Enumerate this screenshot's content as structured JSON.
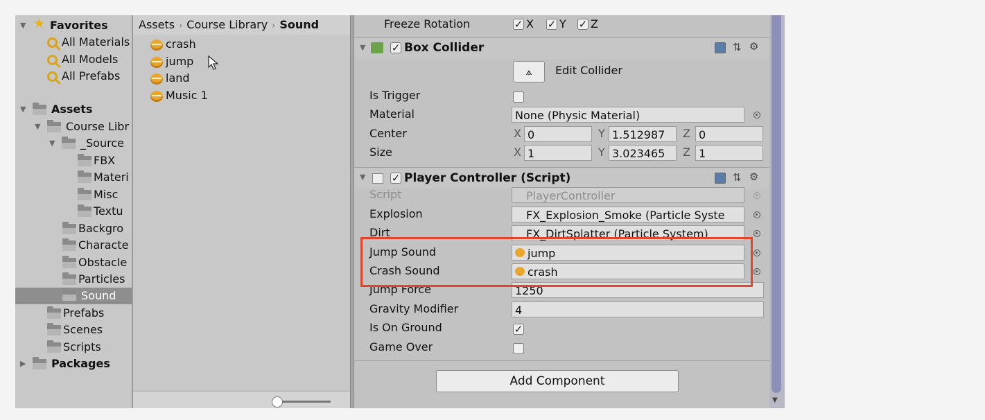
{
  "tree": {
    "favorites_label": "Favorites",
    "favorites": [
      "All Materials",
      "All Models",
      "All Prefabs"
    ],
    "assets_label": "Assets",
    "course_library": "Course Libr",
    "source_folder": "_Source",
    "source_children": [
      "FBX",
      "Materi",
      "Misc",
      "Textu"
    ],
    "course_children": [
      "Backgro",
      "Characte",
      "Obstacle",
      "Particles",
      "Sound"
    ],
    "asset_children": [
      "Prefabs",
      "Scenes",
      "Scripts"
    ],
    "packages_label": "Packages"
  },
  "breadcrumb": [
    "Assets",
    "Course Library",
    "Sound"
  ],
  "asset_files": [
    "crash",
    "jump",
    "land",
    "Music 1"
  ],
  "inspector": {
    "freeze_rotation_label": "Freeze Rotation",
    "freeze_axes": [
      "X",
      "Y",
      "Z"
    ],
    "box_collider": {
      "title": "Box Collider",
      "edit_collider": "Edit Collider",
      "is_trigger_label": "Is Trigger",
      "material_label": "Material",
      "material_value": "None (Physic Material)",
      "center_label": "Center",
      "center": {
        "x": "0",
        "y": "1.512987",
        "z": "0"
      },
      "size_label": "Size",
      "size": {
        "x": "1",
        "y": "3.023465",
        "z": "1"
      },
      "axis_x": "X",
      "axis_y": "Y",
      "axis_z": "Z"
    },
    "player_controller": {
      "title": "Player Controller (Script)",
      "script_label": "Script",
      "script_value": "PlayerController",
      "explosion_label": "Explosion",
      "explosion_value": "FX_Explosion_Smoke (Particle Syste",
      "dirt_label": "Dirt",
      "dirt_value": "FX_DirtSplatter (Particle System)",
      "jump_sound_label": "Jump Sound",
      "jump_sound_value": "jump",
      "crash_sound_label": "Crash Sound",
      "crash_sound_value": "crash",
      "jump_force_label": "Jump Force",
      "jump_force_value": "1250",
      "gravity_label": "Gravity Modifier",
      "gravity_value": "4",
      "is_on_ground_label": "Is On Ground",
      "is_on_ground": true,
      "game_over_label": "Game Over",
      "game_over": false
    },
    "add_component": "Add Component"
  },
  "colors": {
    "highlight": "#e4452a",
    "selected_row": "#8e8e8e",
    "scrollbar": "#8d8fb8"
  }
}
